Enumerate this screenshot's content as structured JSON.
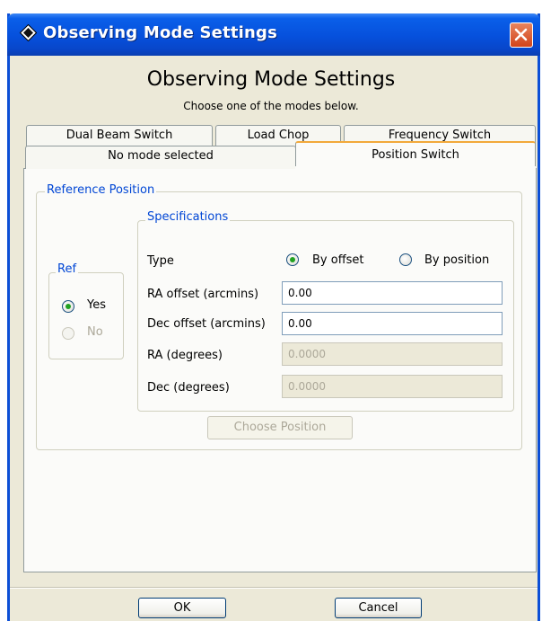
{
  "window": {
    "title": "Observing Mode Settings",
    "app_icon": "diamond-app-icon",
    "close_icon": "close-x-icon"
  },
  "header": {
    "heading": "Observing Mode Settings",
    "subheading": "Choose one of the modes below."
  },
  "tabs": {
    "row1": [
      "Dual Beam Switch",
      "Load Chop",
      "Frequency Switch"
    ],
    "row2": [
      "No mode selected",
      "Position Switch"
    ],
    "selected": "Position Switch"
  },
  "reference_position": {
    "legend": "Reference Position",
    "ref": {
      "legend": "Ref",
      "yes_label": "Yes",
      "no_label": "No",
      "selected": "Yes"
    },
    "specifications": {
      "legend": "Specifications",
      "type_label": "Type",
      "by_offset_label": "By offset",
      "by_position_label": "By position",
      "selected_type": "By offset",
      "ra_offset_label": "RA offset (arcmins)",
      "ra_offset_value": "0.00",
      "dec_offset_label": "Dec offset (arcmins)",
      "dec_offset_value": "0.00",
      "ra_degrees_label": "RA (degrees)",
      "ra_degrees_value": "0.0000",
      "dec_degrees_label": "Dec (degrees)",
      "dec_degrees_value": "0.0000"
    },
    "choose_position_label": "Choose Position"
  },
  "footer": {
    "ok_label": "OK",
    "cancel_label": "Cancel"
  },
  "colors": {
    "titlebar": "#0650dc",
    "window_bg": "#ece9d8",
    "legend_text": "#0046d5",
    "selected_tab_accent": "#f2a93b",
    "radio_dot": "#21a121"
  }
}
